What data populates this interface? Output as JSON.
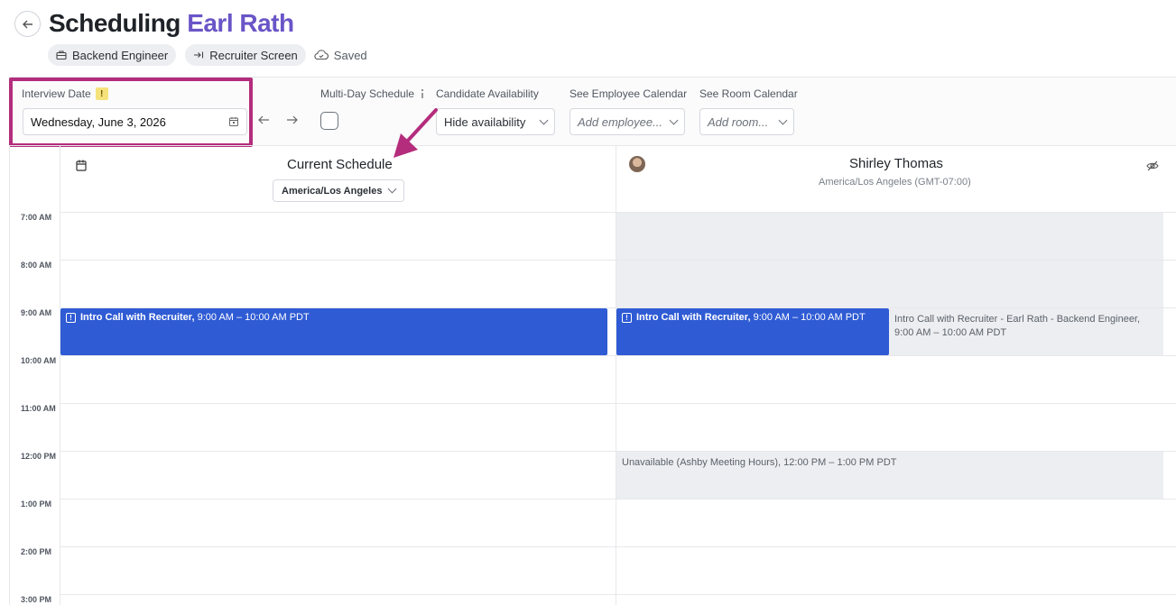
{
  "header": {
    "title_prefix": "Scheduling",
    "candidate_name": "Earl Rath",
    "chips": [
      {
        "label": "Backend Engineer",
        "icon": "briefcase-icon"
      },
      {
        "label": "Recruiter Screen",
        "icon": "stage-arrow-icon"
      }
    ],
    "saved_label": "Saved"
  },
  "toolbar": {
    "interview_date_label": "Interview Date",
    "warning_badge": "!",
    "interview_date_value": "Wednesday, June 3, 2026",
    "multi_day_label": "Multi-Day Schedule",
    "candidate_availability_label": "Candidate Availability",
    "candidate_availability_value": "Hide availability",
    "employee_calendar_label": "See Employee Calendar",
    "employee_calendar_placeholder": "Add employee...",
    "room_calendar_label": "See Room Calendar",
    "room_calendar_placeholder": "Add room..."
  },
  "calendar": {
    "current_schedule_title": "Current Schedule",
    "current_timezone": "America/Los Angeles",
    "employee_name": "Shirley Thomas",
    "employee_timezone": "America/Los Angeles (GMT-07:00)",
    "time_labels": [
      "7:00 AM",
      "8:00 AM",
      "9:00 AM",
      "10:00 AM",
      "11:00 AM",
      "12:00 PM",
      "1:00 PM",
      "2:00 PM",
      "3:00 PM"
    ],
    "events": {
      "current_intro_title": "Intro Call with Recruiter,",
      "current_intro_time": "9:00 AM – 10:00 AM PDT",
      "employee_intro_title": "Intro Call with Recruiter,",
      "employee_intro_time": "9:00 AM – 10:00 AM PDT",
      "employee_gray_title": "Intro Call with Recruiter - Earl Rath - Backend Engineer,",
      "employee_gray_time": "9:00 AM – 10:00 AM PDT",
      "unavailable_title": "Unavailable (Ashby Meeting Hours),",
      "unavailable_time": "12:00 PM – 1:00 PM PDT"
    }
  },
  "colors": {
    "accent_purple": "#6a55c7",
    "event_blue": "#2f5bd4",
    "highlight_magenta": "#b42d7c"
  }
}
